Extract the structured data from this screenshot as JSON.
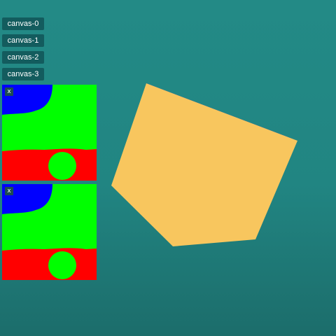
{
  "buttons": [
    {
      "label": "canvas-0"
    },
    {
      "label": "canvas-1"
    },
    {
      "label": "canvas-2"
    },
    {
      "label": "canvas-3"
    }
  ],
  "panels": [
    {
      "close_label": "x"
    },
    {
      "close_label": "x"
    }
  ],
  "colors": {
    "background": "#218582",
    "button": "#135c5e",
    "texture_blue": "#0000ff",
    "texture_green": "#00ff00",
    "texture_red": "#ff0000",
    "cube_face": "#f8c65e"
  }
}
